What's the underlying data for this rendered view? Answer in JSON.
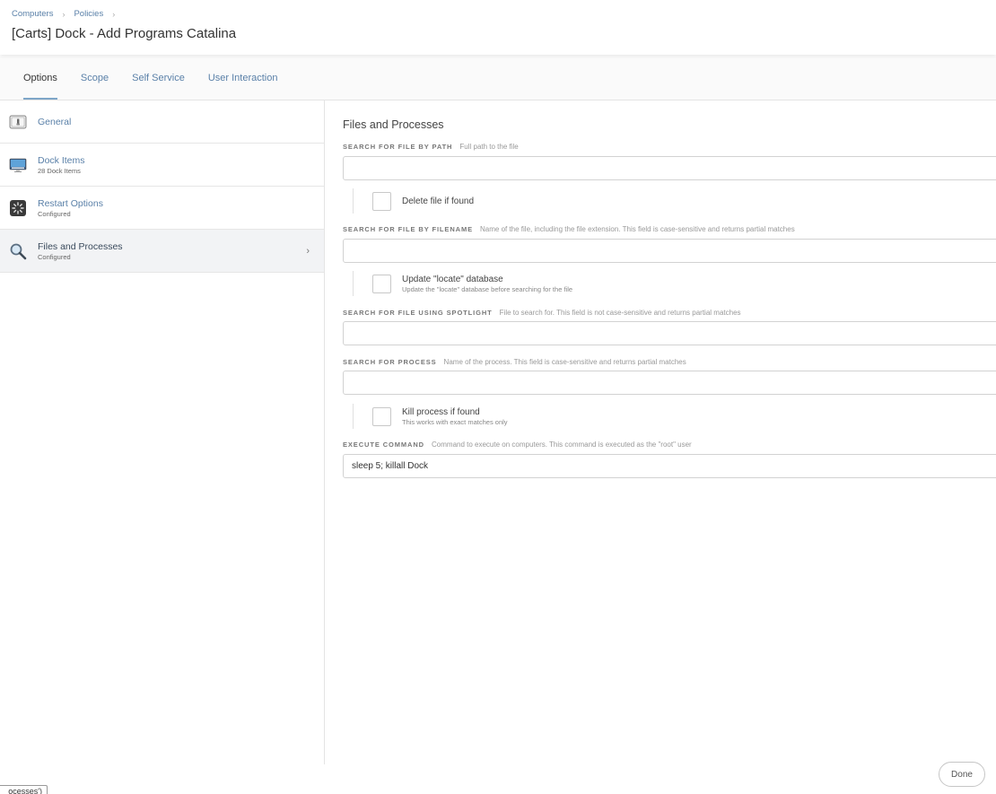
{
  "breadcrumb": {
    "items": [
      "Computers",
      "Policies"
    ]
  },
  "page": {
    "title": "[Carts] Dock - Add Programs Catalina"
  },
  "tabs": [
    {
      "label": "Options",
      "active": true
    },
    {
      "label": "Scope"
    },
    {
      "label": "Self Service"
    },
    {
      "label": "User Interaction"
    }
  ],
  "sidebar": {
    "items": [
      {
        "title": "General",
        "subtitle": "",
        "icon": "general-icon"
      },
      {
        "title": "Dock Items",
        "subtitle": "28 Dock Items",
        "icon": "dock-icon"
      },
      {
        "title": "Restart Options",
        "subtitle": "Configured",
        "icon": "restart-icon"
      },
      {
        "title": "Files and Processes",
        "subtitle": "Configured",
        "icon": "magnifier-icon",
        "active": true
      }
    ]
  },
  "main": {
    "section_title": "Files and Processes",
    "search_path": {
      "label": "SEARCH FOR FILE BY PATH",
      "hint": "Full path to the file",
      "value": ""
    },
    "delete_file": {
      "label": "Delete file if found",
      "checked": false
    },
    "search_filename": {
      "label": "SEARCH FOR FILE BY FILENAME",
      "hint": "Name of the file, including the file extension. This field is case-sensitive and returns partial matches",
      "value": ""
    },
    "update_locate": {
      "label": "Update \"locate\" database",
      "sub": "Update the \"locate\" database before searching for the file",
      "checked": false
    },
    "search_spotlight": {
      "label": "SEARCH FOR FILE USING SPOTLIGHT",
      "hint": "File to search for. This field is not case-sensitive and returns partial matches",
      "value": ""
    },
    "search_process": {
      "label": "SEARCH FOR PROCESS",
      "hint": "Name of the process. This field is case-sensitive and returns partial matches",
      "value": ""
    },
    "kill_process": {
      "label": "Kill process if found",
      "sub": "This works with exact matches only",
      "checked": false
    },
    "execute_command": {
      "label": "EXECUTE COMMAND",
      "hint": "Command to execute on computers. This command is executed as the \"root\" user",
      "value": "sleep 5; killall Dock"
    }
  },
  "footer": {
    "done_label": "Done"
  },
  "clipped_tab": {
    "label": "ocesses')"
  },
  "colors": {
    "link": "#5a80a8",
    "active_tab_underline": "#7ea6c8"
  }
}
